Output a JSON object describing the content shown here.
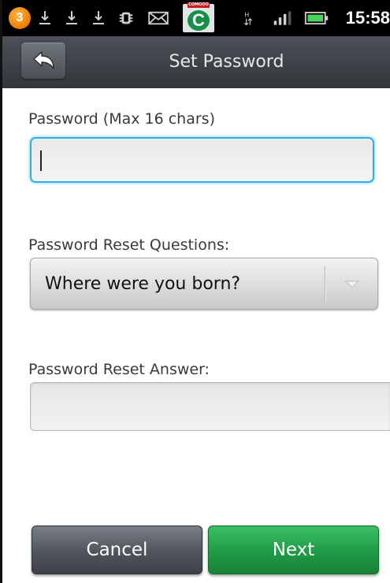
{
  "status_bar": {
    "notification_count": "3",
    "time": "15:58",
    "icons": [
      "notification-badge-icon",
      "download-icon",
      "download-icon",
      "download-icon",
      "usb-debug-icon",
      "email-icon",
      "comodo-app-icon",
      "data-hplus-icon",
      "signal-icon",
      "battery-icon"
    ]
  },
  "header": {
    "title": "Set Password"
  },
  "form": {
    "password_label": "Password (Max 16 chars)",
    "password_value": "",
    "questions_label": "Password Reset Questions:",
    "selected_question": "Where were you born?",
    "answer_label": "Password Reset Answer:",
    "answer_value": ""
  },
  "buttons": {
    "cancel": "Cancel",
    "next": "Next"
  },
  "colors": {
    "focus_border": "#2fb0e3",
    "next_button": "#1f9a47",
    "cancel_button": "#50555b",
    "title_bar": "#3f4449"
  }
}
